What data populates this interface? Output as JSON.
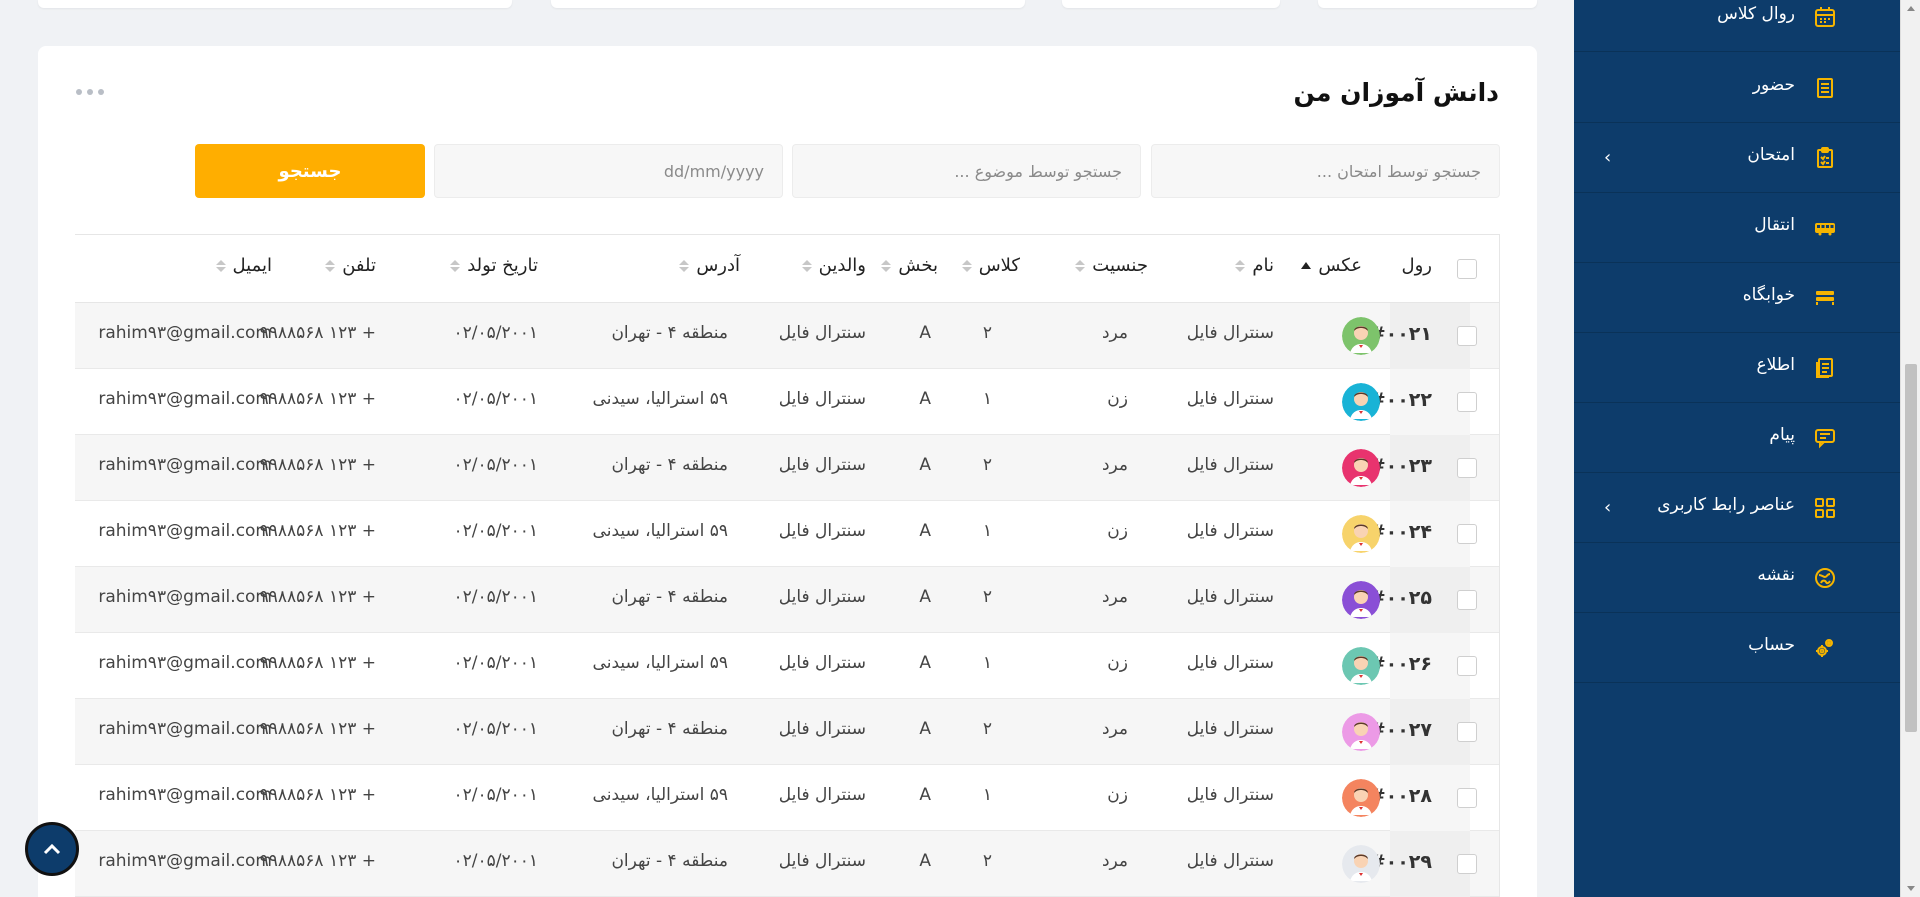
{
  "card": {
    "title": "دانش آموزان من",
    "filters": {
      "exam_placeholder": "جستجو توسط امتحان ...",
      "subject_placeholder": "جستجو توسط موضوع ...",
      "date_placeholder": "dd/mm/yyyy",
      "search_label": "جستجو"
    }
  },
  "table": {
    "headers": {
      "roll": "رول",
      "photo": "عکس",
      "name": "نام",
      "gender": "جنسیت",
      "class": "کلاس",
      "section": "بخش",
      "parents": "والدین",
      "address": "آدرس",
      "birth_date": "تاریخ تولد",
      "phone": "تلفن",
      "email": "ایمیل"
    },
    "rows": [
      {
        "roll": "#۰۰۲۱",
        "name": "سنترال فایل",
        "gender": "مرد",
        "class": "۲",
        "section": "A",
        "parents": "سنترال فایل",
        "address": "منطقه ۴ - تهران",
        "birth_date": "۰۲/۰۵/۲۰۰۱",
        "phone": "+ ۱۲۳ ۹۹۸۸۵۶۸",
        "email": "rahim۹۳@gmail.com",
        "avatar_color": "#7dc36b"
      },
      {
        "roll": "#۰۰۲۲",
        "name": "سنترال فایل",
        "gender": "زن",
        "class": "۱",
        "section": "A",
        "parents": "سنترال فایل",
        "address": "۵۹ استرالیا، سیدنی",
        "birth_date": "۰۲/۰۵/۲۰۰۱",
        "phone": "+ ۱۲۳ ۹۹۸۸۵۶۸",
        "email": "rahim۹۳@gmail.com",
        "avatar_color": "#19b3d6"
      },
      {
        "roll": "#۰۰۲۳",
        "name": "سنترال فایل",
        "gender": "مرد",
        "class": "۲",
        "section": "A",
        "parents": "سنترال فایل",
        "address": "منطقه ۴ - تهران",
        "birth_date": "۰۲/۰۵/۲۰۰۱",
        "phone": "+ ۱۲۳ ۹۹۸۸۵۶۸",
        "email": "rahim۹۳@gmail.com",
        "avatar_color": "#e8336e"
      },
      {
        "roll": "#۰۰۲۴",
        "name": "سنترال فایل",
        "gender": "زن",
        "class": "۱",
        "section": "A",
        "parents": "سنترال فایل",
        "address": "۵۹ استرالیا، سیدنی",
        "birth_date": "۰۲/۰۵/۲۰۰۱",
        "phone": "+ ۱۲۳ ۹۹۸۸۵۶۸",
        "email": "rahim۹۳@gmail.com",
        "avatar_color": "#f7d36b"
      },
      {
        "roll": "#۰۰۲۵",
        "name": "سنترال فایل",
        "gender": "مرد",
        "class": "۲",
        "section": "A",
        "parents": "سنترال فایل",
        "address": "منطقه ۴ - تهران",
        "birth_date": "۰۲/۰۵/۲۰۰۱",
        "phone": "+ ۱۲۳ ۹۹۸۸۵۶۸",
        "email": "rahim۹۳@gmail.com",
        "avatar_color": "#8a4fd6"
      },
      {
        "roll": "#۰۰۲۶",
        "name": "سنترال فایل",
        "gender": "زن",
        "class": "۱",
        "section": "A",
        "parents": "سنترال فایل",
        "address": "۵۹ استرالیا، سیدنی",
        "birth_date": "۰۲/۰۵/۲۰۰۱",
        "phone": "+ ۱۲۳ ۹۹۸۸۵۶۸",
        "email": "rahim۹۳@gmail.com",
        "avatar_color": "#6cc7b2"
      },
      {
        "roll": "#۰۰۲۷",
        "name": "سنترال فایل",
        "gender": "مرد",
        "class": "۲",
        "section": "A",
        "parents": "سنترال فایل",
        "address": "منطقه ۴ - تهران",
        "birth_date": "۰۲/۰۵/۲۰۰۱",
        "phone": "+ ۱۲۳ ۹۹۸۸۵۶۸",
        "email": "rahim۹۳@gmail.com",
        "avatar_color": "#ec9ae6"
      },
      {
        "roll": "#۰۰۲۸",
        "name": "سنترال فایل",
        "gender": "زن",
        "class": "۱",
        "section": "A",
        "parents": "سنترال فایل",
        "address": "۵۹ استرالیا، سیدنی",
        "birth_date": "۰۲/۰۵/۲۰۰۱",
        "phone": "+ ۱۲۳ ۹۹۸۸۵۶۸",
        "email": "rahim۹۳@gmail.com",
        "avatar_color": "#f4845f"
      },
      {
        "roll": "#۰۰۲۹",
        "name": "سنترال فایل",
        "gender": "مرد",
        "class": "۲",
        "section": "A",
        "parents": "سنترال فایل",
        "address": "منطقه ۴ - تهران",
        "birth_date": "۰۲/۰۵/۲۰۰۱",
        "phone": "+ ۱۲۳ ۹۹۸۸۵۶۸",
        "email": "rahim۹۳@gmail.com",
        "avatar_color": "#e6e9ee"
      }
    ]
  },
  "sidebar": {
    "items": [
      {
        "label": "روال کلاس",
        "icon": "calendar-icon"
      },
      {
        "label": "حضور",
        "icon": "clipboard-list-icon"
      },
      {
        "label": "امتحان",
        "icon": "checklist-icon",
        "has_submenu": true
      },
      {
        "label": "انتقال",
        "icon": "bus-icon"
      },
      {
        "label": "خوابگاه",
        "icon": "bed-icon"
      },
      {
        "label": "اطلاع",
        "icon": "document-icon"
      },
      {
        "label": "پیام",
        "icon": "chat-icon"
      },
      {
        "label": "عناصر رابط کاربری",
        "icon": "grid-icon",
        "has_submenu": true
      },
      {
        "label": "نقشه",
        "icon": "map-icon"
      },
      {
        "label": "حساب",
        "icon": "gears-icon"
      }
    ]
  },
  "colors": {
    "accent": "#ffae00",
    "sidebar_bg": "#0d3c6b",
    "icon_yellow": "#f5b400"
  }
}
